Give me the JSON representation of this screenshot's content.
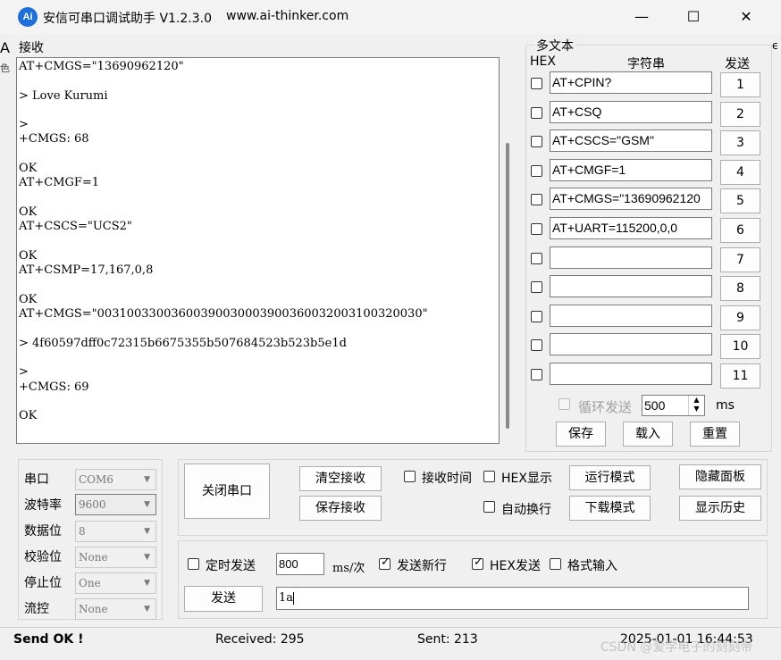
{
  "window": {
    "title": "安信可串口调试助手 V1.2.3.0",
    "url": "www.ai-thinker.com",
    "icon_text": "Ai",
    "minimize": "—",
    "maximize": "☐",
    "close": "✕"
  },
  "edge": {
    "a": "A",
    "b": "色",
    "r": "ϵ"
  },
  "receive": {
    "label": "接收",
    "lines": [
      "AT+CMGS=\"13690962120\"",
      "",
      "> Love Kurumi",
      "",
      ">",
      "+CMGS: 68",
      "",
      "OK",
      "AT+CMGF=1",
      "",
      "OK",
      "AT+CSCS=\"UCS2\"",
      "",
      "OK",
      "AT+CSMP=17,167,0,8",
      "",
      "OK",
      "AT+CMGS=\"00310033003600390030003900360032003100320030\"",
      "",
      "> 4f60597dff0c72315b6675355b507684523b523b5e1d",
      "",
      ">",
      "+CMGS: 69",
      "",
      "OK"
    ]
  },
  "multi": {
    "title": "多文本",
    "col_hex": "HEX",
    "col_string": "字符串",
    "col_send": "发送",
    "rows": [
      {
        "value": "AT+CPIN?",
        "button": "1"
      },
      {
        "value": "AT+CSQ",
        "button": "2"
      },
      {
        "value": "AT+CSCS=\"GSM\"",
        "button": "3"
      },
      {
        "value": "AT+CMGF=1",
        "button": "4"
      },
      {
        "value": "AT+CMGS=\"13690962120",
        "button": "5"
      },
      {
        "value": "AT+UART=115200,0,0",
        "button": "6"
      },
      {
        "value": "",
        "button": "7"
      },
      {
        "value": "",
        "button": "8"
      },
      {
        "value": "",
        "button": "9"
      },
      {
        "value": "",
        "button": "10"
      },
      {
        "value": "",
        "button": "11"
      }
    ],
    "loop_label": "循环发送",
    "loop_interval": "500",
    "loop_unit": "ms",
    "save": "保存",
    "load": "载入",
    "reset": "重置"
  },
  "settings": {
    "port_label": "串口",
    "port_value": "COM6",
    "baud_label": "波特率",
    "baud_value": "9600",
    "data_label": "数据位",
    "data_value": "8",
    "parity_label": "校验位",
    "parity_value": "None",
    "stop_label": "停止位",
    "stop_value": "One",
    "flow_label": "流控",
    "flow_value": "None"
  },
  "controls": {
    "close_port": "关闭串口",
    "clear_recv": "清空接收",
    "save_recv": "保存接收",
    "recv_time": "接收时间",
    "hex_display": "HEX显示",
    "auto_wrap": "自动换行",
    "run_mode": "运行模式",
    "download_mode": "下载模式",
    "hide_panel": "隐藏面板",
    "show_history": "显示历史"
  },
  "send": {
    "timed_send": "定时发送",
    "interval": "800",
    "interval_unit": "ms/次",
    "send_newline": "发送新行",
    "send_newline_checked": true,
    "hex_send": "HEX发送",
    "hex_send_checked": true,
    "format_input": "格式输入",
    "send_button": "发送",
    "input_value": "1a"
  },
  "status": {
    "message": "Send OK !",
    "received": "Received: 295",
    "sent": "Sent: 213",
    "time": "2025-01-01 16:44:53",
    "watermark": "CSDN @爱学电子的刻刻帝"
  }
}
